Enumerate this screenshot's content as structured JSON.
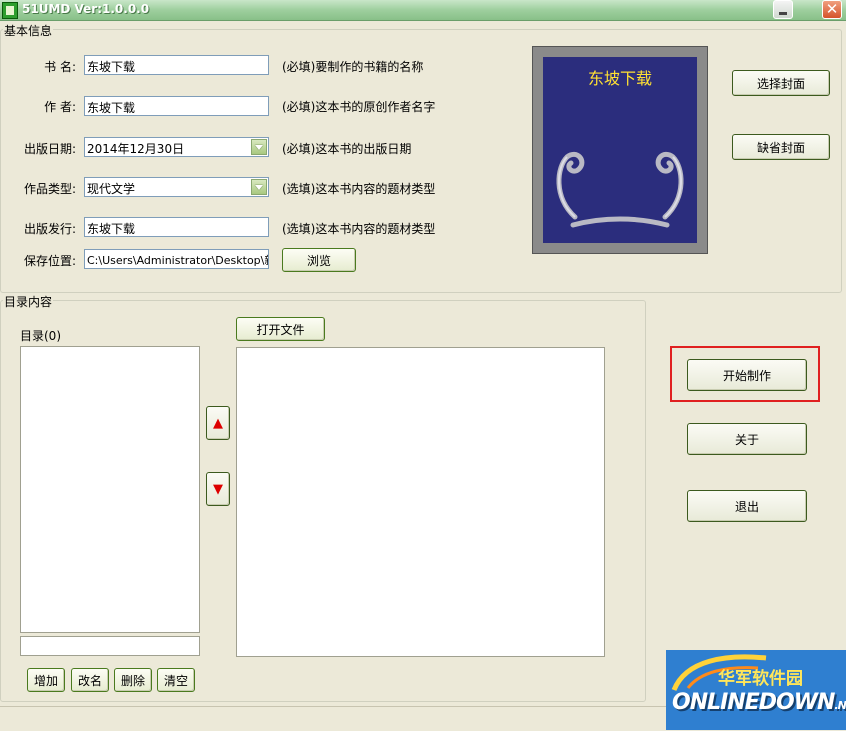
{
  "window": {
    "title": "51UMD Ver:1.0.0.0",
    "close_symbol": "✕"
  },
  "basic_info": {
    "legend": "基本信息",
    "rows": [
      {
        "label": "书   名:",
        "value": "东坡下载",
        "note": "(必填)要制作的书籍的名称"
      },
      {
        "label": "作   者:",
        "value": "东坡下载",
        "note": "(必填)这本书的原创作者名字"
      },
      {
        "label": "出版日期:",
        "value": "2014年12月30日",
        "note": "(必填)这本书的出版日期"
      },
      {
        "label": "作品类型:",
        "value": "现代文学",
        "note": "(选填)这本书内容的题材类型"
      },
      {
        "label": "出版发行:",
        "value": "东坡下载",
        "note": "(选填)这本书内容的题材类型"
      },
      {
        "label": "保存位置:",
        "value": "C:\\Users\\Administrator\\Desktop\\新建",
        "note": ""
      }
    ],
    "browse_label": "浏览",
    "cover_title": "东坡下载",
    "select_cover_label": "选择封面",
    "default_cover_label": "缺省封面"
  },
  "toc": {
    "legend": "目录内容",
    "list_label": "目录(0)",
    "open_file_label": "打开文件",
    "add_label": "增加",
    "rename_label": "改名",
    "delete_label": "删除",
    "clear_label": "清空",
    "up_symbol": "▲",
    "down_symbol": "▼"
  },
  "actions": {
    "start_label": "开始制作",
    "about_label": "关于",
    "exit_label": "退出"
  },
  "watermark": {
    "cn": "华军软件园",
    "en": "ONLINEDOWN",
    "suffix": ".NET"
  }
}
